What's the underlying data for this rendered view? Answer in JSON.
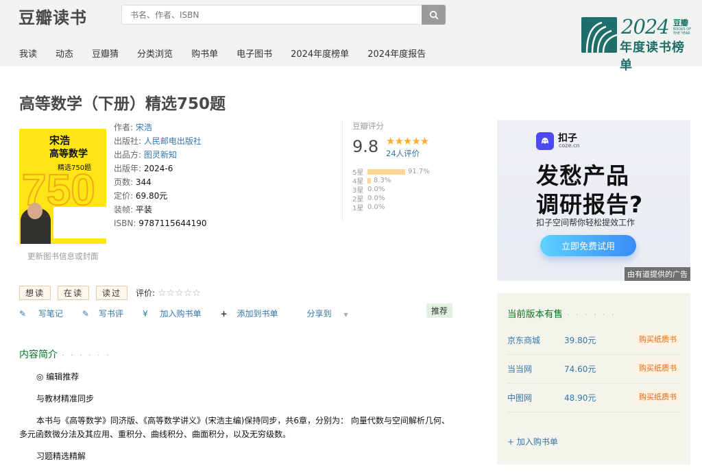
{
  "header": {
    "logo": "豆瓣读书",
    "search_placeholder": "书名、作者、ISBN",
    "nav": [
      "我读",
      "动态",
      "豆瓣猜",
      "分类浏览",
      "购书单",
      "电子图书",
      "2024年度榜单",
      "2024年度报告"
    ],
    "year_badge": {
      "year": "2024",
      "brand": "豆瓣",
      "small": "BOOKS OF THE YEAR",
      "caption": "年度读书榜单"
    }
  },
  "book": {
    "title": "高等数学（下册）精选750题",
    "cover": {
      "author": "宋浩",
      "title": "高等数学",
      "subtitle": "精选750题",
      "big_number": "750"
    },
    "update_link": "更新图书信息或封面",
    "info": [
      {
        "label": "作者:",
        "value": "宋浩",
        "link": true
      },
      {
        "label": "出版社:",
        "value": "人民邮电出版社",
        "link": true
      },
      {
        "label": "出品方:",
        "value": "图灵新知",
        "link": true
      },
      {
        "label": "出版年:",
        "value": "2024-6",
        "link": false
      },
      {
        "label": "页数:",
        "value": "344",
        "link": false
      },
      {
        "label": "定价:",
        "value": "69.80元",
        "link": false
      },
      {
        "label": "装帧:",
        "value": "平装",
        "link": false
      },
      {
        "label": "ISBN:",
        "value": "9787115644190",
        "link": false
      }
    ]
  },
  "rating": {
    "label": "豆瓣评分",
    "score": "9.8",
    "stars": "★★★★★",
    "count": "24人评价",
    "breakdown": [
      {
        "label": "5星",
        "percent": 91.7,
        "text": "91.7%"
      },
      {
        "label": "4星",
        "percent": 8.3,
        "text": "8.3%"
      },
      {
        "label": "3星",
        "percent": 0,
        "text": "0.0%"
      },
      {
        "label": "2星",
        "percent": 0,
        "text": "0.0%"
      },
      {
        "label": "1星",
        "percent": 0,
        "text": "0.0%"
      }
    ]
  },
  "ad": {
    "brand": "扣子",
    "domain": "coze.cn",
    "headline1": "发愁产品",
    "headline2": "调研报告?",
    "sub": "扣子空间帮你轻松提效工作",
    "button": "立即免费试用",
    "tag": "由有道提供的广告"
  },
  "actions": {
    "buttons": [
      "想读",
      "在读",
      "读过"
    ],
    "rate_label": "评价:",
    "rate_stars": "☆☆☆☆☆",
    "links": [
      "写笔记",
      "写书评",
      "加入购书单",
      "添加到书单"
    ],
    "link_icons": [
      "✎",
      "✎",
      "¥",
      "+"
    ],
    "share": "分享到",
    "recommend": "推荐"
  },
  "intro": {
    "title": "内容简介",
    "dots": "· · · · · ·",
    "paragraphs": [
      "◎ 编辑推荐",
      "与教材精准同步",
      "本书与《高等数学》同济版、《高等数学讲义》(宋浩主编)保持同步，共6章，分别为： 向量代数与空间解析几何、多元函数微分法及其应用、重积分、曲线积分、曲面积分，以及无穷级数。",
      "习题精选精解"
    ]
  },
  "buy": {
    "title": "当前版本有售",
    "dots": "· · · · · ·",
    "shops": [
      {
        "name": "京东商城",
        "price": "39.80元",
        "button": "购买纸质书"
      },
      {
        "name": "当当网",
        "price": "74.60元",
        "button": "购买纸质书"
      },
      {
        "name": "中图网",
        "price": "48.90元",
        "button": "购买纸质书"
      }
    ],
    "add_cart": "+ 加入购书单"
  },
  "colors": {
    "green": "#007722",
    "link": "#3377aa",
    "star": "#ffac2d",
    "teal": "#1e6f6b"
  }
}
